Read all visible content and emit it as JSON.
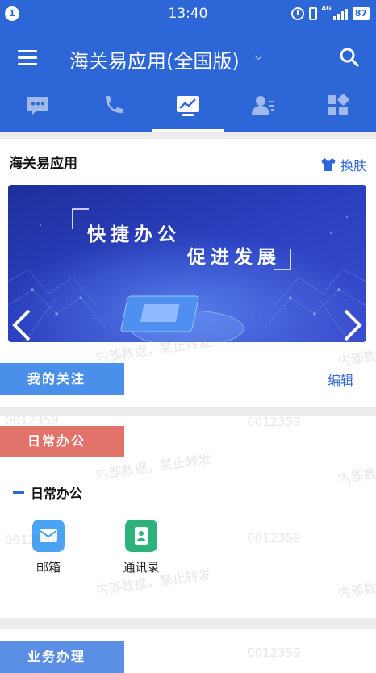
{
  "status_bar": {
    "notification_count": "1",
    "time": "13:40",
    "network_label": "4G",
    "battery": "87"
  },
  "header": {
    "title": "海关易应用(全国版)",
    "tabs": [
      {
        "icon": "message-icon",
        "active": false
      },
      {
        "icon": "phone-icon",
        "active": false
      },
      {
        "icon": "dashboard-icon",
        "active": true
      },
      {
        "icon": "contacts-icon",
        "active": false
      },
      {
        "icon": "apps-grid-icon",
        "active": false
      }
    ]
  },
  "main": {
    "section_title": "海关易应用",
    "skin_label": "换肤",
    "banner": {
      "line1": "快捷办公",
      "line2": "促进发展",
      "slide_count": 3,
      "active_slide": 3
    },
    "follow_label": "我的关注",
    "edit_label": "编辑",
    "daily_label": "日常办公",
    "daily_subsection": "日常办公",
    "apps": [
      {
        "label": "邮箱",
        "icon": "mail-icon",
        "color": "#4aa3f3"
      },
      {
        "label": "通讯录",
        "icon": "address-book-icon",
        "color": "#2cb27a"
      }
    ],
    "business_label": "业务办理"
  },
  "watermark": {
    "text": "内部数据，禁止转发",
    "code": "0012359"
  },
  "colors": {
    "primary": "#2d66d6",
    "follow_tag": "#4a8fe9",
    "daily_tag": "#e2736b",
    "business_tag": "#5b8fe6"
  }
}
